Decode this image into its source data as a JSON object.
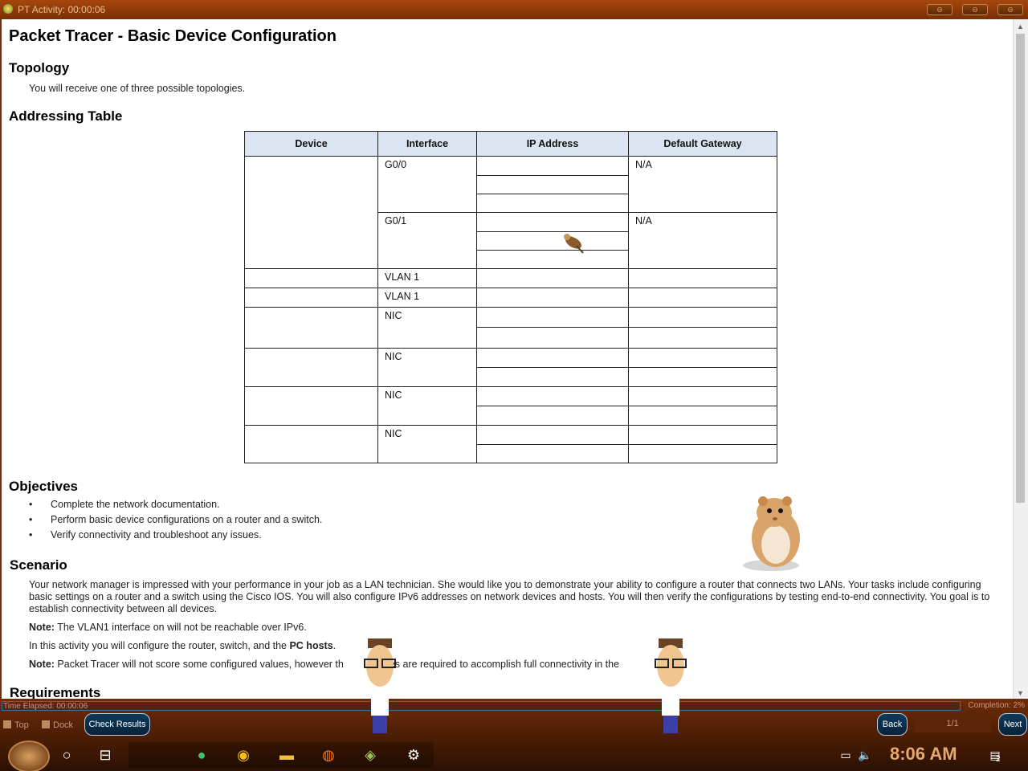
{
  "window": {
    "title": "PT Activity: 00:00:06",
    "controls": [
      "⊖",
      "⊖",
      "⊖"
    ]
  },
  "doc": {
    "title": "Packet Tracer - Basic Device Configuration",
    "topology_heading": "Topology",
    "topology_text": "You will receive one of three possible topologies.",
    "addressing_heading": "Addressing Table",
    "table_headers": [
      "Device",
      "Interface",
      "IP Address",
      "Default Gateway"
    ],
    "table": {
      "g00": "G0/0",
      "g01": "G0/1",
      "na1": "N/A",
      "na2": "N/A",
      "vlan1a": "VLAN 1",
      "vlan1b": "VLAN 1",
      "nic1": "NIC",
      "nic2": "NIC",
      "nic3": "NIC",
      "nic4": "NIC"
    },
    "objectives_heading": "Objectives",
    "objectives": [
      "Complete the network documentation.",
      "Perform basic device configurations on a router and a switch.",
      "Verify connectivity and troubleshoot any issues."
    ],
    "scenario_heading": "Scenario",
    "scenario_p1": "Your network manager is impressed with your performance in your job as a LAN technician. She would like you to demonstrate your ability to configure a router that connects two LANs. Your tasks include configuring basic settings on a router and a switch using the Cisco IOS. You will also configure IPv6 addresses on network devices and hosts. You will then verify the configurations by testing end-to-end connectivity. You goal is to establish connectivity between all devices.",
    "note1_label": "Note:",
    "note1_text": " The VLAN1 interface on will not be reachable over IPv6.",
    "p3_text": "In this activity you will configure the router, switch, and the ",
    "p3_bold": "PC hosts",
    "p3_end": ".",
    "note2_label": "Note:",
    "note2_text": " Packet Tracer will not score some configured values, however th",
    "note2_text2": "ues are required to accomplish full connectivity in the",
    "requirements_heading": "Requirements"
  },
  "status": {
    "time_elapsed": "Time Elapsed: 00:00:06",
    "completion": "Completion: 2%",
    "top_label": "Top",
    "dock_label": "Dock",
    "check_results": "Check Results",
    "back": "Back",
    "page": "1/1",
    "next": "Next"
  },
  "taskbar": {
    "clock": "8:06 AM",
    "notif_count": "2"
  },
  "colors": {
    "accent": "#7a2f06",
    "table_header": "#dbe5f1",
    "clock": "#e6a96b"
  }
}
